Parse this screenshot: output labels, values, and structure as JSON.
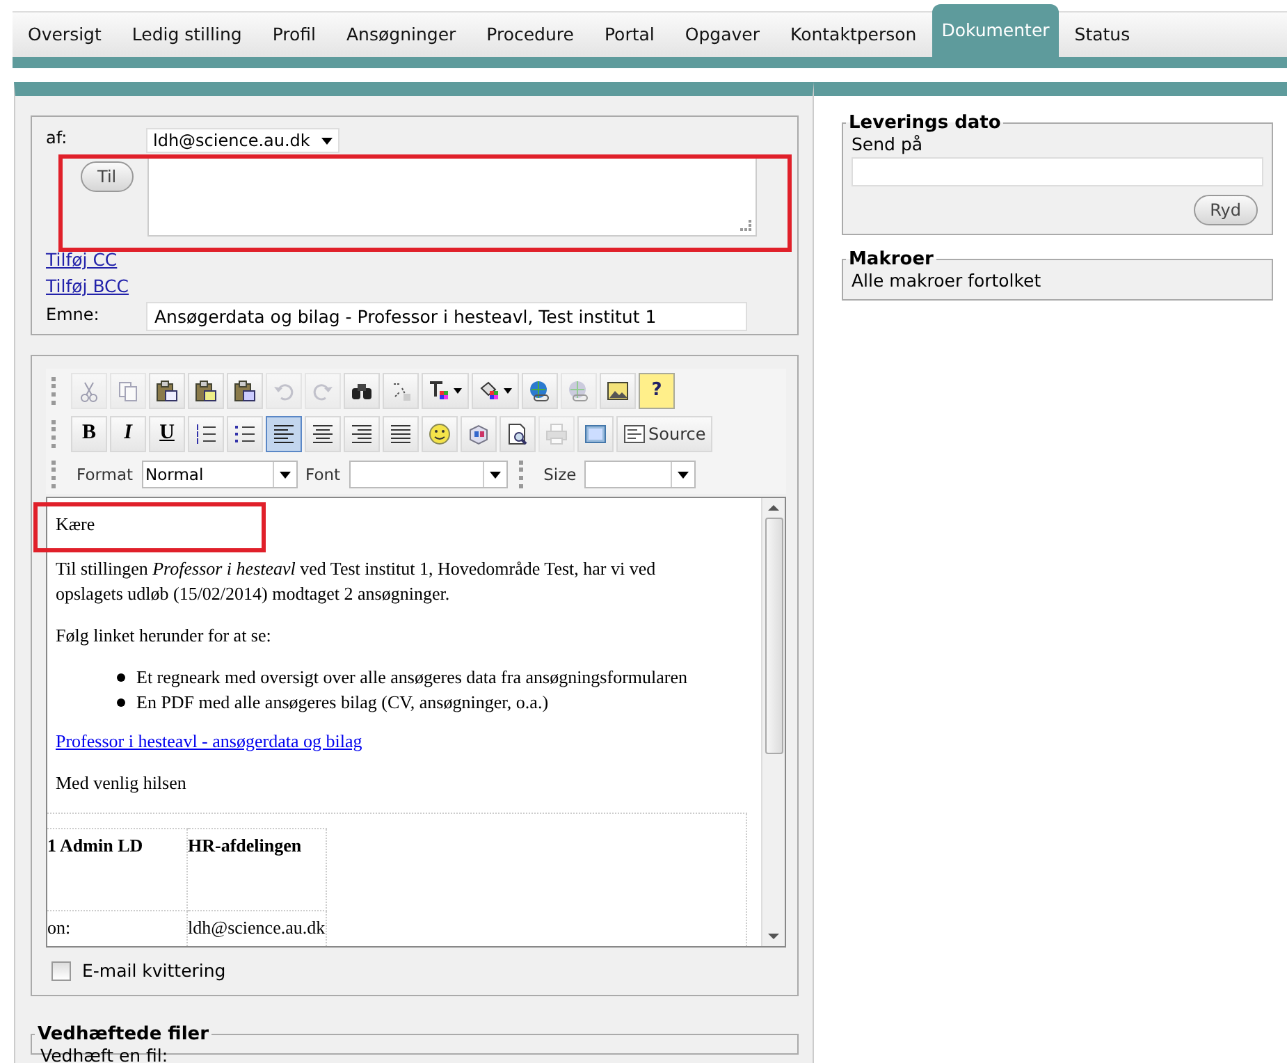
{
  "tabs": [
    {
      "label": "Oversigt",
      "selected": false
    },
    {
      "label": "Ledig stilling",
      "selected": false
    },
    {
      "label": "Profil",
      "selected": false
    },
    {
      "label": "Ansøgninger",
      "selected": false
    },
    {
      "label": "Procedure",
      "selected": false
    },
    {
      "label": "Portal",
      "selected": false
    },
    {
      "label": "Opgaver",
      "selected": false
    },
    {
      "label": "Kontaktperson",
      "selected": false
    },
    {
      "label": "Dokumenter",
      "selected": true
    },
    {
      "label": "Status",
      "selected": false
    }
  ],
  "message": {
    "from_label": "af:",
    "from_value": "ldh@science.au.dk",
    "to_button": "Til",
    "links": [
      "Tilføj CC",
      "Tilføj BCC"
    ],
    "subject_label": "Emne:",
    "subject_value": "Ansøgerdata og bilag - Professor i hesteavl, Test institut 1"
  },
  "editor": {
    "toolbar_rows": [
      [
        {
          "kind": "cut",
          "disabled": true,
          "selected": false
        },
        {
          "kind": "copy",
          "disabled": true,
          "selected": false
        },
        {
          "kind": "paste",
          "disabled": false,
          "selected": false
        },
        {
          "kind": "paste-text",
          "disabled": false,
          "selected": false
        },
        {
          "kind": "paste-word",
          "disabled": false,
          "selected": false
        },
        {
          "kind": "undo",
          "disabled": true,
          "selected": false
        },
        {
          "kind": "redo",
          "disabled": true,
          "selected": false
        },
        {
          "kind": "find",
          "disabled": false,
          "selected": false
        },
        {
          "kind": "replace",
          "disabled": false,
          "selected": false
        },
        {
          "kind": "text-color",
          "disabled": false,
          "selected": false
        },
        {
          "kind": "back-color",
          "disabled": false,
          "selected": false
        },
        {
          "kind": "link",
          "disabled": false,
          "selected": false
        },
        {
          "kind": "unlink",
          "disabled": true,
          "selected": false
        },
        {
          "kind": "image",
          "disabled": false,
          "selected": false
        },
        {
          "kind": "help",
          "disabled": false,
          "selected": false,
          "glyph": "?"
        }
      ],
      [
        {
          "kind": "bold",
          "disabled": false,
          "selected": false,
          "glyph": "B"
        },
        {
          "kind": "italic",
          "disabled": false,
          "selected": false,
          "glyph": "I"
        },
        {
          "kind": "underline",
          "disabled": false,
          "selected": false,
          "glyph": "U"
        },
        {
          "kind": "ordered-list",
          "disabled": false,
          "selected": false
        },
        {
          "kind": "bullet-list",
          "disabled": false,
          "selected": false
        },
        {
          "kind": "align-left",
          "disabled": false,
          "selected": true
        },
        {
          "kind": "align-center",
          "disabled": false,
          "selected": false
        },
        {
          "kind": "align-right",
          "disabled": false,
          "selected": false
        },
        {
          "kind": "justify",
          "disabled": false,
          "selected": false
        },
        {
          "kind": "smiley",
          "disabled": false,
          "selected": false
        },
        {
          "kind": "special",
          "disabled": false,
          "selected": false
        },
        {
          "kind": "preview",
          "disabled": false,
          "selected": false
        },
        {
          "kind": "print",
          "disabled": true,
          "selected": false
        },
        {
          "kind": "blocks",
          "disabled": false,
          "selected": false
        },
        {
          "kind": "source",
          "disabled": false,
          "selected": false,
          "label": "Source"
        }
      ]
    ],
    "format_label": "Format",
    "format_value": "Normal",
    "font_label": "Font",
    "size_label": "Size",
    "body": [
      {
        "kind": "paragraph",
        "text": "Kære"
      },
      {
        "kind": "paragraph",
        "text": "Til stillingen *Professor i hesteavl* ved Test institut 1, Hovedområde Test, har vi ved opslagets udløb (15/02/2014) modtaget 2 ansøgninger."
      },
      {
        "kind": "paragraph",
        "text": "Følg linket herunder for at se:"
      },
      {
        "kind": "list",
        "items": [
          "Et regneark med oversigt over alle ansøgeres data fra ansøgningsformularen",
          "En PDF med alle ansøgeres bilag (CV, ansøgninger, o.a.)"
        ]
      },
      {
        "kind": "link",
        "text": "Professor i hesteavl - ansøgerdata og bilag"
      },
      {
        "kind": "paragraph",
        "text": "Med venlig hilsen"
      }
    ],
    "signature": [
      [
        "1 Admin LD",
        "HR-afdelingen"
      ],
      [
        "on:",
        "ldh@science.au.dk"
      ]
    ]
  },
  "receipt": {
    "label": "E-mail kvittering",
    "checked": false
  },
  "attachments": {
    "title": "Vedhæftede filer",
    "label": "Vedhæft en fil:"
  },
  "delivery": {
    "title": "Leverings dato",
    "label": "Send på",
    "clear_button": "Ryd"
  },
  "macros": {
    "title": "Makroer",
    "text": "Alle makroer fortolket"
  }
}
